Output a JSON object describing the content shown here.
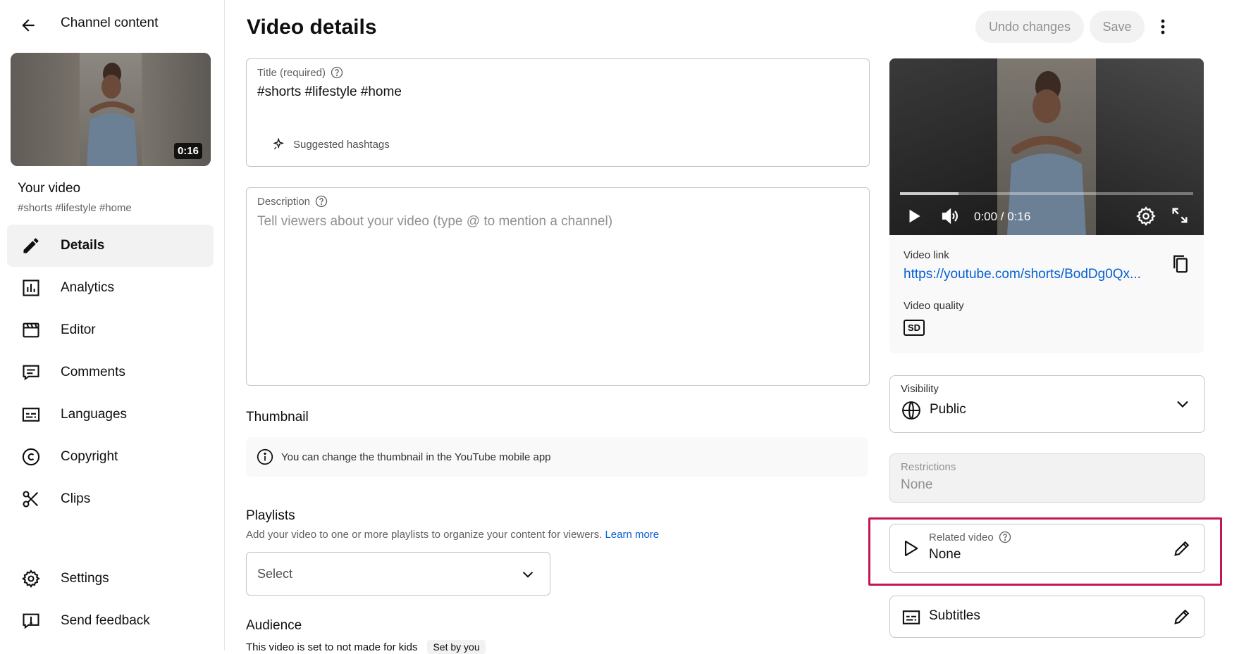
{
  "sidebar": {
    "title": "Channel content",
    "thumbnail_duration": "0:16",
    "your_video_label": "Your video",
    "video_tags": "#shorts #lifestyle #home",
    "nav": [
      {
        "label": "Details",
        "icon": "pencil-icon",
        "active": true
      },
      {
        "label": "Analytics",
        "icon": "analytics-icon"
      },
      {
        "label": "Editor",
        "icon": "clapperboard-icon"
      },
      {
        "label": "Comments",
        "icon": "comment-icon"
      },
      {
        "label": "Languages",
        "icon": "subtitles-icon"
      },
      {
        "label": "Copyright",
        "icon": "copyright-icon"
      },
      {
        "label": "Clips",
        "icon": "scissors-icon"
      }
    ],
    "settings_label": "Settings",
    "feedback_label": "Send feedback"
  },
  "header": {
    "title": "Video details",
    "undo_label": "Undo changes",
    "save_label": "Save"
  },
  "title_field": {
    "label": "Title (required)",
    "value": "#shorts #lifestyle #home",
    "suggested_label": "Suggested hashtags"
  },
  "description_field": {
    "label": "Description",
    "placeholder": "Tell viewers about your video (type @ to mention a channel)"
  },
  "thumbnail": {
    "heading": "Thumbnail",
    "info": "You can change the thumbnail in the YouTube mobile app"
  },
  "playlists": {
    "heading": "Playlists",
    "description": "Add your video to one or more playlists to organize your content for viewers.",
    "learn_more": "Learn more",
    "select_value": "Select"
  },
  "audience": {
    "heading": "Audience",
    "status": "This video is set to not made for kids",
    "badge": "Set by you"
  },
  "preview": {
    "time": "0:00 / 0:16",
    "progress": 0.2,
    "video_link_label": "Video link",
    "video_link": "https://youtube.com/shorts/BodDg0Qx...",
    "quality_label": "Video quality",
    "quality_badge": "SD"
  },
  "visibility": {
    "label": "Visibility",
    "value": "Public"
  },
  "restrictions": {
    "label": "Restrictions",
    "value": "None"
  },
  "related_video": {
    "label": "Related video",
    "value": "None"
  },
  "subtitles": {
    "label": "Subtitles"
  },
  "colors": {
    "accent_link": "#065fd4",
    "highlight": "#c4174f"
  }
}
